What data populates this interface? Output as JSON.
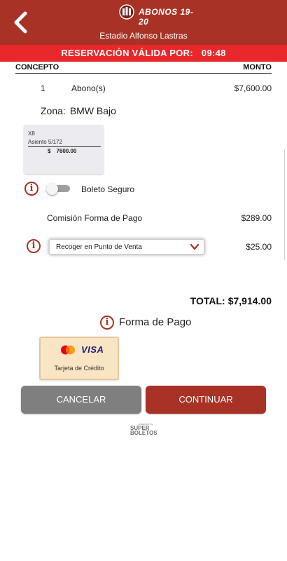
{
  "header": {
    "logo_text": "ABONOS 19-20",
    "venue": "Estadio Alfonso Lastras",
    "brand_color": "#a93226"
  },
  "timer": {
    "label": "RESERVACIÓN VÁLIDA POR:",
    "value": "09:48",
    "color": "#e8282b"
  },
  "table": {
    "col_concept": "CONCEPTO",
    "col_amount": "MONTO",
    "rows": [
      {
        "qty": "1",
        "item": "Abono(s)",
        "price": "$7,600.00"
      }
    ]
  },
  "zona": {
    "label": "Zona:",
    "value": "BMW Bajo"
  },
  "seat": {
    "row": "X8",
    "seat": "Asiento 5/172",
    "currency": "$",
    "price": "7600.00"
  },
  "seguro": {
    "label": "Boleto Seguro",
    "enabled": false
  },
  "fee": {
    "label": "Comisión Forma de Pago",
    "price": "$289.00"
  },
  "delivery": {
    "selected": "Recoger en Punto de Venta",
    "price": "$25.00"
  },
  "total": {
    "label": "TOTAL:",
    "value": "$7,914.00"
  },
  "payment": {
    "title": "Forma de Pago",
    "option_label": "Tarjeta de Crédito",
    "visa_text": "VISA"
  },
  "buttons": {
    "cancel": "CANCELAR",
    "continue": "CONTINUAR"
  },
  "footer": {
    "powered_small": "powered by",
    "brand_line1": "SUPER",
    "brand_line2": "BOLETOS"
  }
}
